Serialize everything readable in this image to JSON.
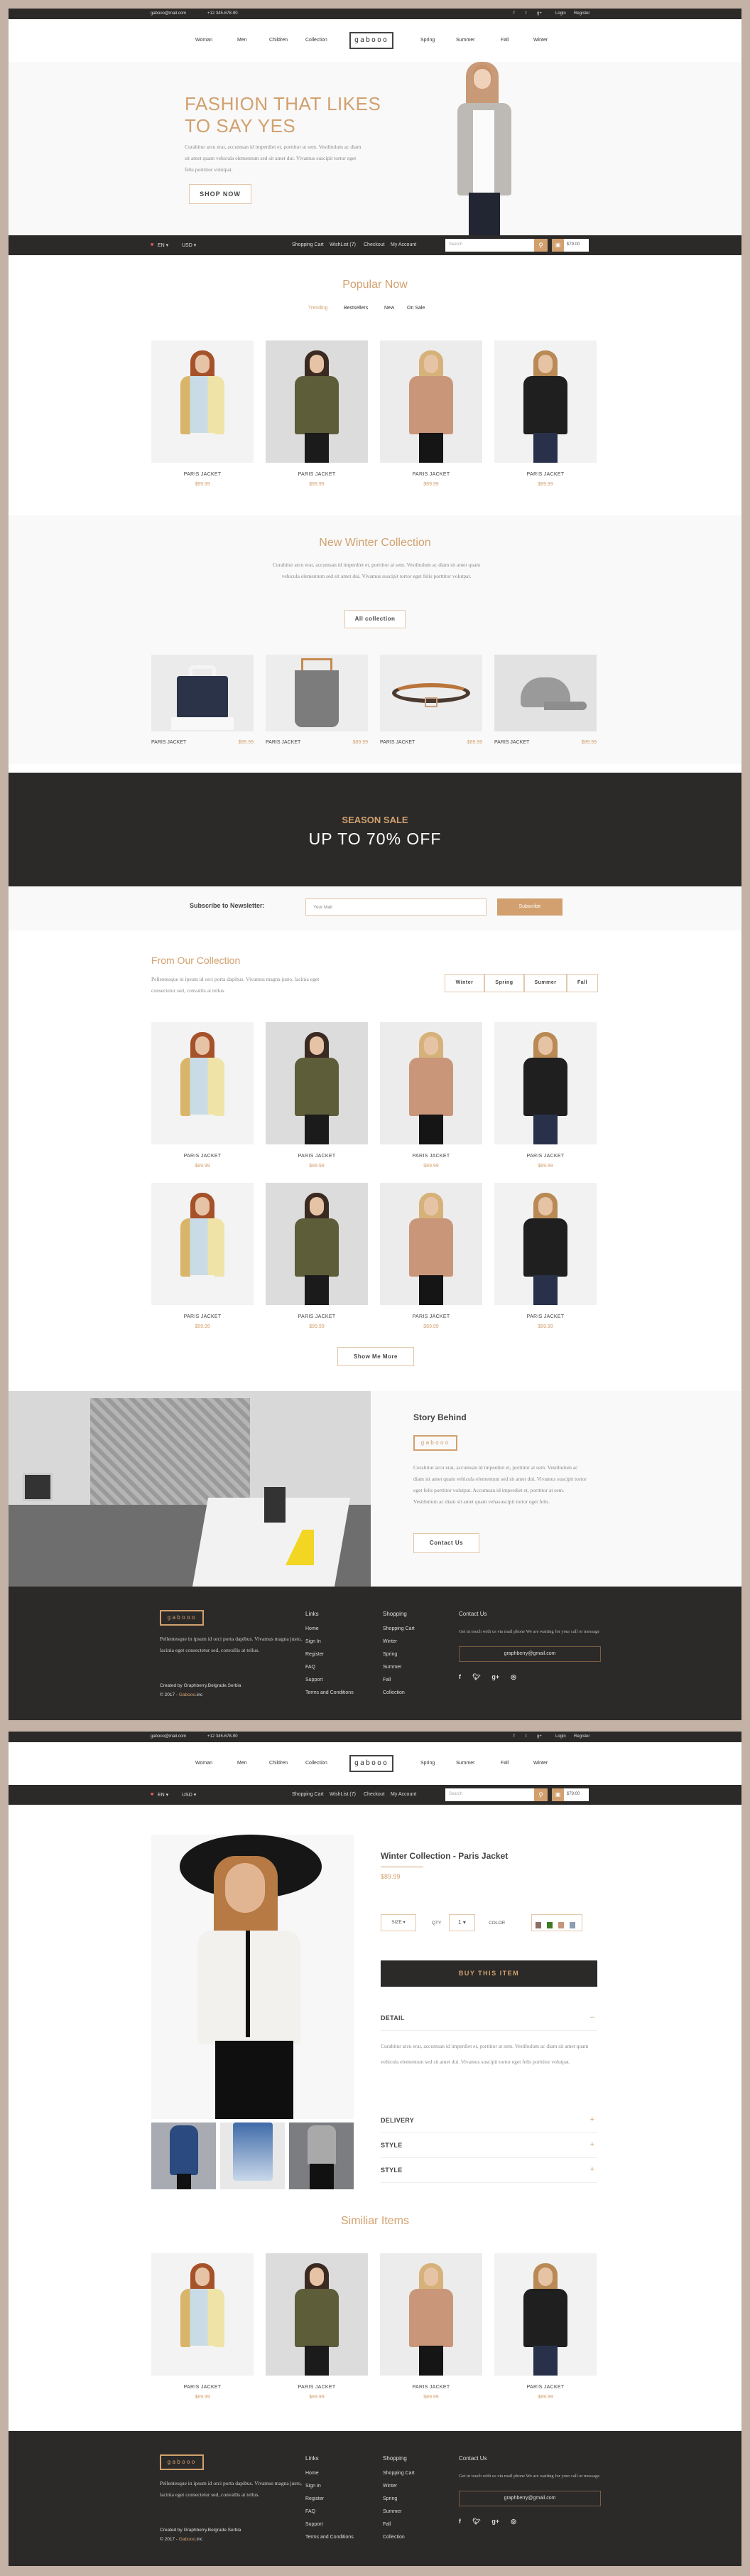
{
  "header": {
    "email": "gabooo@mail.com",
    "phone": "+12 345-678-90",
    "social": [
      "f",
      "t",
      "g+"
    ],
    "login": "Login",
    "register": "Register",
    "nav_left": [
      "Woman",
      "Men",
      "Children",
      "Collection"
    ],
    "nav_right": [
      "Spring",
      "Summer",
      "Fall",
      "Winter"
    ],
    "active_nav": "Woman",
    "logo": "gabooo",
    "lang": "EN",
    "currency": "USD",
    "account_links": [
      "Shopping Cart",
      "WishList (7)",
      "Checkout",
      "My Account"
    ],
    "search_placeholder": "Search",
    "cart_total": "$79.00"
  },
  "hero": {
    "title_line1": "FASHION THAT LIKES",
    "title_line2": "TO SAY YES",
    "text": "Curabitur arcu erat, accumsan id imperdiet et, porttitor at sem. Vestibulum ac diam sit amet quam vehicula elementum sed sit amet dui. Vivamus suscipit tortor eget felis porttitor volutpat.",
    "button": "SHOP NOW"
  },
  "popular": {
    "title": "Popular Now",
    "tabs": [
      "Trending",
      "Bestsellers",
      "New",
      "On Sale"
    ],
    "active_tab": "Trending",
    "products": [
      {
        "name": "PARIS JACKET",
        "price": "$89.99"
      },
      {
        "name": "PARIS JACKET",
        "price": "$89.99"
      },
      {
        "name": "PARIS JACKET",
        "price": "$89.99"
      },
      {
        "name": "PARIS JACKET",
        "price": "$89.99"
      }
    ]
  },
  "winter": {
    "title": "New Winter Collection",
    "text": "Curabitur arcu erat, accumsan id imperdiet et, porttitor at sem. Vestibulum ac diam sit amet quam vehicula elementum sed sit amet dui. Vivamus suscipit tortor eget felis porttitor volutpat.",
    "button": "All collection",
    "products": [
      {
        "name": "PARIS JACKET",
        "price": "$89.99"
      },
      {
        "name": "PARIS JACKET",
        "price": "$89.99"
      },
      {
        "name": "PARIS JACKET",
        "price": "$89.99"
      },
      {
        "name": "PARIS JACKET",
        "price": "$89.99"
      }
    ]
  },
  "sale": {
    "label": "SEASON SALE",
    "headline": "UP TO 70% OFF"
  },
  "newsletter": {
    "label": "Subscribe to Newsletter:",
    "placeholder": "Your Mail",
    "button": "Subscribe"
  },
  "collection": {
    "title": "From Our Collection",
    "text": "Pellentesque in ipsum id orci porta dapibus. Vivamus magna justo, lacinia eget consectetur sed, convallis at tellus.",
    "filters": [
      "Winter",
      "Spring",
      "Summer",
      "Fall"
    ],
    "products": [
      {
        "name": "PARIS JACKET",
        "price": "$89.99"
      },
      {
        "name": "PARIS JACKET",
        "price": "$89.99"
      },
      {
        "name": "PARIS JACKET",
        "price": "$89.99"
      },
      {
        "name": "PARIS JACKET",
        "price": "$89.99"
      },
      {
        "name": "PARIS JACKET",
        "price": "$89.99"
      },
      {
        "name": "PARIS JACKET",
        "price": "$89.99"
      },
      {
        "name": "PARIS JACKET",
        "price": "$89.99"
      },
      {
        "name": "PARIS JACKET",
        "price": "$89.99"
      }
    ],
    "more_button": "Show Me More"
  },
  "story": {
    "title": "Story Behind",
    "badge": "gabooo",
    "text": "Curabitur arcu erat, accumsan id imperdiet et, porttitor at sem. Vestibulum ac diam sit amet quam vehicula elementum sed sit amet dui. Vivamus suscipit tortor eget felis porttitor volutpat. Accumsan id imperdiet et, porttitor at sem. Vestibulum ac diam sit amet quam vehasuscipit tortor eget felis.",
    "button": "Contact Us"
  },
  "footer": {
    "logo": "gabooo",
    "text": "Pellentesque in ipsum id orci porta dapibus. Vivamus magna justo, lacinia eget consectetur sed, convallis at tellus.",
    "credit": "Created by Graphberry.Belgrade.Serbia",
    "copyright_prefix": "© 2017 - ",
    "copyright_brand": "Gabooo",
    "copyright_suffix": ".inc",
    "links_title": "Links",
    "links": [
      "Home",
      "Sign In",
      "Register",
      "FAQ",
      "Support",
      "Terms and Conditions"
    ],
    "shopping_title": "Shopping",
    "shopping": [
      "Shopping Cart",
      "Winter",
      "Spring",
      "Summer",
      "Fall",
      "Collection"
    ],
    "contact_title": "Contact Us",
    "contact_text": "Get in touch with us via mail phone We are waiting for your call or message",
    "contact_email": "graphberry@gmail.com",
    "social": [
      "f",
      "t",
      "g+",
      "dribbble"
    ]
  },
  "product": {
    "title": "Winter Collection - Paris Jacket",
    "price": "$89.99",
    "size_label": "SIZE",
    "qty_label": "QTY",
    "qty_value": "1",
    "color_label": "COLOR",
    "colors": [
      "#8a6e64",
      "#3f7a22",
      "#c9957a",
      "#8d9db3"
    ],
    "buy_button": "BUY THIS ITEM",
    "detail_title": "DETAIL",
    "detail_text": "Curabitur arcu erat, accumsan id imperdiet et, porttitor at sem. Vestibulum ac diam sit amet quam vehicula elementum sed sit amet dui. Vivamus suscipit tortor eget felis porttitor volutpat.",
    "accordions": [
      "DELIVERY",
      "STYLE",
      "STYLE"
    ]
  },
  "similar": {
    "title": "Similiar Items",
    "products": [
      {
        "name": "PARIS JACKET",
        "price": "$89.99"
      },
      {
        "name": "PARIS JACKET",
        "price": "$89.99"
      },
      {
        "name": "PARIS JACKET",
        "price": "$89.99"
      },
      {
        "name": "PARIS JACKET",
        "price": "$89.99"
      }
    ]
  }
}
